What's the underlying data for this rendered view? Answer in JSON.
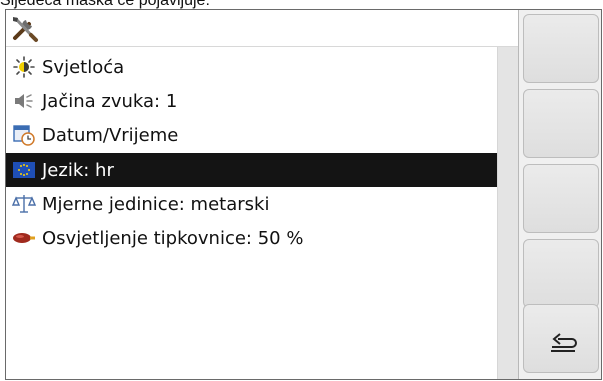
{
  "caption": "Sljedeća maska će pojavljuje:",
  "title_bar": {
    "icon": "tools-icon"
  },
  "settings": [
    {
      "icon": "brightness-icon",
      "label": "Svjetloća",
      "selected": false
    },
    {
      "icon": "speaker-icon",
      "label": "Jačina zvuka: 1",
      "selected": false
    },
    {
      "icon": "calendar-clock-icon",
      "label": "Datum/Vrijeme",
      "selected": false
    },
    {
      "icon": "eu-flag-icon",
      "label": "Jezik: hr",
      "selected": true
    },
    {
      "icon": "scale-icon",
      "label": "Mjerne jedinice: metarski",
      "selected": false
    },
    {
      "icon": "keyboard-light-icon",
      "label": "Osvjetljenje tipkovnice:  50 %",
      "selected": false
    }
  ],
  "softkeys": [
    {
      "icon": ""
    },
    {
      "icon": ""
    },
    {
      "icon": ""
    },
    {
      "icon": ""
    },
    {
      "icon": "back-arrow-icon"
    }
  ],
  "colors": {
    "selection_bg": "#141414",
    "selection_fg": "#ffffff",
    "softkey_bg": "#e4e4e4",
    "scrollbar": "#e4e4e4"
  }
}
